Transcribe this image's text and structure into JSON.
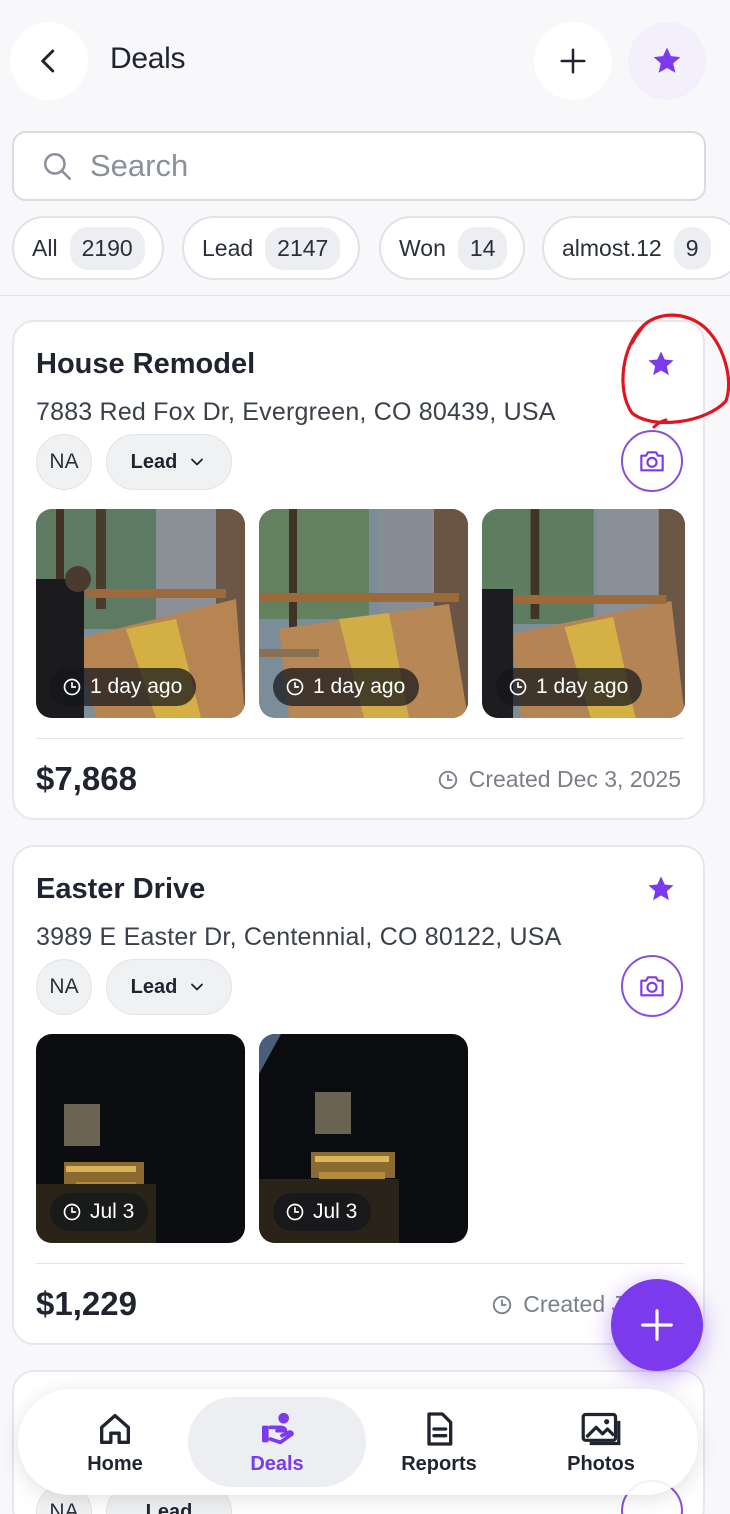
{
  "header": {
    "title": "Deals",
    "back_icon": "chevron-left-icon",
    "add_icon": "plus-icon",
    "favorites_icon": "star-icon"
  },
  "search": {
    "placeholder": "Search"
  },
  "filters": [
    {
      "label": "All",
      "count": "2190"
    },
    {
      "label": "Lead",
      "count": "2147"
    },
    {
      "label": "Won",
      "count": "14"
    },
    {
      "label": "almost.12",
      "count": "9"
    }
  ],
  "deals": [
    {
      "title": "House Remodel",
      "address": "7883 Red Fox Dr, Evergreen, CO 80439, USA",
      "assignee": "NA",
      "stage": "Lead",
      "photos": [
        {
          "time": "1 day ago"
        },
        {
          "time": "1 day ago"
        },
        {
          "time": "1 day ago"
        }
      ],
      "price": "$7,868",
      "created": "Created Dec 3, 2025",
      "favorited": true
    },
    {
      "title": "Easter Drive",
      "address": "3989 E Easter Dr, Centennial, CO 80122, USA",
      "assignee": "NA",
      "stage": "Lead",
      "photos": [
        {
          "time": "Jul 3"
        },
        {
          "time": "Jul 3"
        }
      ],
      "price": "$1,229",
      "created": "Created J",
      "favorited": true
    },
    {
      "assignee": "NA",
      "stage": "Lead"
    }
  ],
  "nav": [
    {
      "label": "Home",
      "icon": "home-icon"
    },
    {
      "label": "Deals",
      "icon": "deals-icon",
      "active": true
    },
    {
      "label": "Reports",
      "icon": "document-icon"
    },
    {
      "label": "Photos",
      "icon": "photos-icon"
    }
  ],
  "colors": {
    "accent": "#7c3aed",
    "annotation": "#e0151f",
    "background": "#f8f8fa"
  }
}
